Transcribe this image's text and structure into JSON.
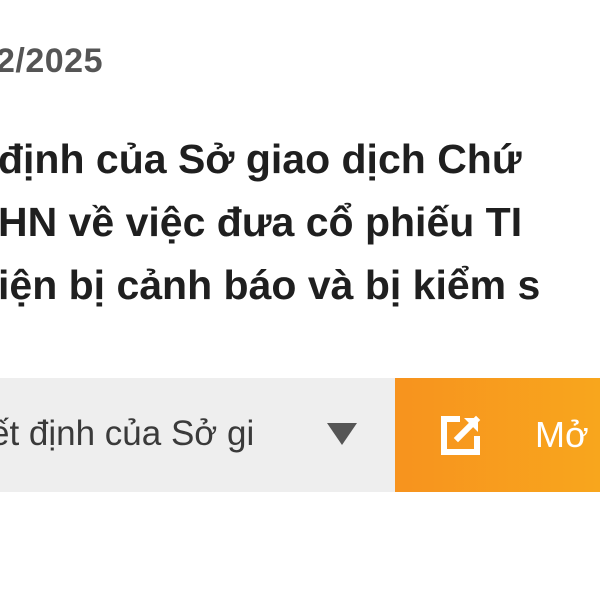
{
  "article": {
    "date": "2/2025",
    "title_lines": [
      "định của Sở giao dịch Chứ",
      "HN về việc đưa cổ phiếu TI",
      "iện bị cảnh báo và bị kiểm s"
    ]
  },
  "document_bar": {
    "selected_document": "ết định của Sở gi",
    "open_button_label": "Mở",
    "icons": {
      "dropdown": "caret-down-icon",
      "open": "external-link-icon"
    },
    "colors": {
      "selector_background": "#eeeeee",
      "button_accent": "#f7931e"
    }
  }
}
